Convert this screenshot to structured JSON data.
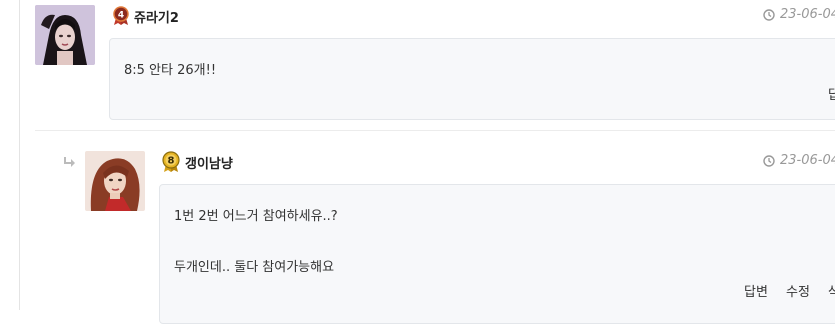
{
  "comments": [
    {
      "nickname": "쥬라기2",
      "level": "4",
      "date": "23-06-04",
      "body_lines": [
        "8:5  안타 26개!!"
      ],
      "actions": [
        "답"
      ]
    },
    {
      "nickname": "갱이남냥",
      "level": "8",
      "date": "23-06-04",
      "body_lines": [
        "1번 2번 어느거 참여하세유..?",
        "두개인데.. 둘다 참여가능해요"
      ],
      "actions": [
        "답변",
        "수정",
        "삭"
      ]
    }
  ],
  "icons": {
    "clock": "clock-icon",
    "reply_arrow": "reply-arrow-icon"
  },
  "colors": {
    "bubble_bg": "#f7f8fa",
    "bubble_border": "#e3e6ea",
    "date_text": "#999999",
    "level4_badge": "#c0392b",
    "level8_badge": "#e6b422"
  }
}
